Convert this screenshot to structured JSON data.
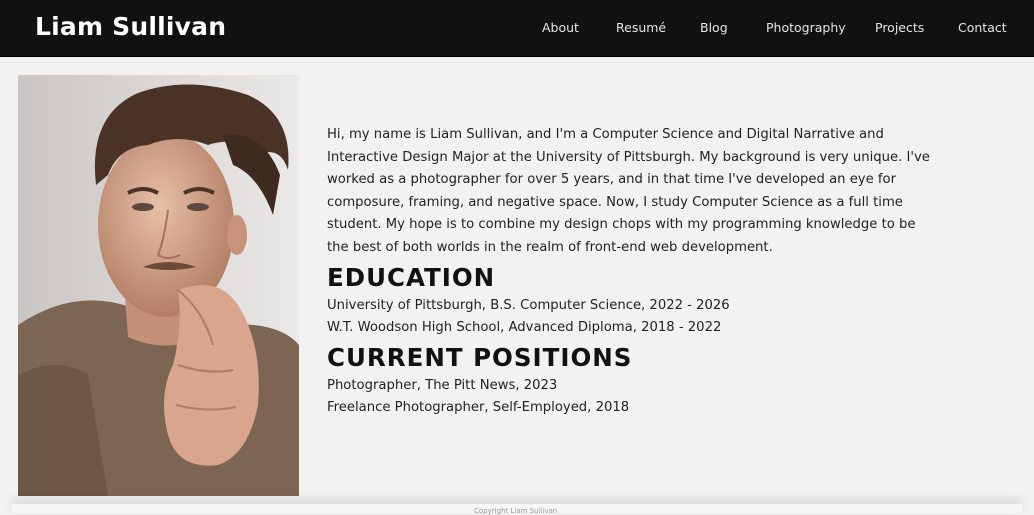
{
  "header": {
    "site_title": "Liam Sullivan",
    "nav": [
      "About",
      "Resumé",
      "Blog",
      "Photography",
      "Projects",
      "Contact"
    ]
  },
  "portrait": {
    "icon": "portrait-photo"
  },
  "about": {
    "bio": "Hi, my name is Liam Sullivan, and I'm a Computer Science and Digital Narrative and Interactive Design Major at the University of Pittsburgh. My background is very unique. I've worked as a photographer for over 5 years, and in that time I've developed an eye for composure, framing, and negative space. Now, I study Computer Science as a full time student. My hope is to combine my design chops with my programming knowledge to be the best of both worlds in the realm of front-end web development.",
    "education_heading": "EDUCATION",
    "education": [
      "University of Pittsburgh, B.S. Computer Science, 2022 - 2026",
      "W.T. Woodson High School, Advanced Diploma, 2018 - 2022"
    ],
    "positions_heading": "CURRENT POSITIONS",
    "positions": [
      "Photographer, The Pitt News, 2023",
      "Freelance Photographer, Self-Employed, 2018"
    ]
  },
  "footer": {
    "text": "Copyright Liam Sullivan"
  },
  "colors": {
    "navbar": "#111111",
    "page_background": "#f2f2f2",
    "text": "#222222"
  }
}
